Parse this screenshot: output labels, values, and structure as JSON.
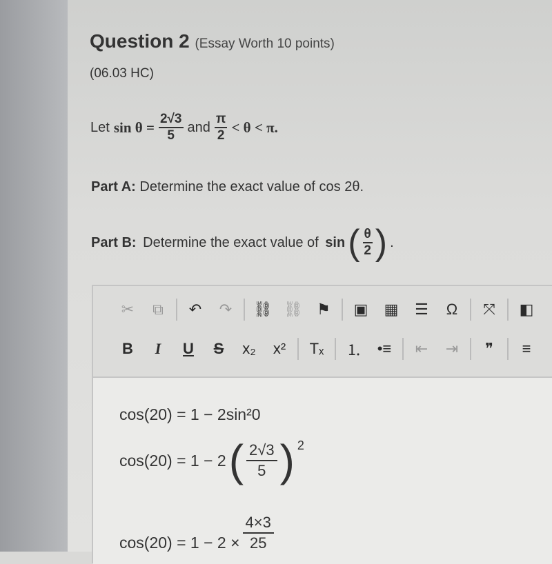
{
  "question": {
    "title": "Question 2",
    "worth": "(Essay Worth 10 points)",
    "code": "(06.03 HC)"
  },
  "given": {
    "let": "Let",
    "sin": "sin θ =",
    "num": "2√3",
    "den": "5",
    "and": "and",
    "pi": "π",
    "two": "2",
    "ineq": "< θ < π."
  },
  "part_a": {
    "label": "Part A:",
    "text": " Determine the exact value of cos 2θ."
  },
  "part_b": {
    "label": "Part B:",
    "text": " Determine the exact value of ",
    "fn": "sin",
    "num": "θ",
    "den": "2",
    "end": "."
  },
  "toolbar": {
    "row1": [
      {
        "icon": "cut-icon",
        "g": "✂",
        "dim": true
      },
      {
        "icon": "copy-icon",
        "g": "⧉",
        "dim": true
      },
      {
        "sep": true
      },
      {
        "icon": "undo-icon",
        "g": "↶"
      },
      {
        "icon": "redo-icon",
        "g": "↷",
        "dim": true
      },
      {
        "sep": true
      },
      {
        "icon": "link-icon",
        "g": "⛓"
      },
      {
        "icon": "unlink-icon",
        "g": "⛓",
        "dim": true
      },
      {
        "icon": "flag-icon",
        "g": "⚑"
      },
      {
        "sep": true
      },
      {
        "icon": "image-icon",
        "g": "▣"
      },
      {
        "icon": "table-icon",
        "g": "▦"
      },
      {
        "icon": "horizontal-line-icon",
        "g": "☰"
      },
      {
        "icon": "omega-icon",
        "g": "Ω"
      },
      {
        "sep": true
      },
      {
        "icon": "maximize-icon",
        "g": "⤧"
      },
      {
        "sep": true
      },
      {
        "icon": "source-icon",
        "g": "◧"
      }
    ],
    "row2": [
      {
        "icon": "bold-icon",
        "g": "B"
      },
      {
        "icon": "italic-icon",
        "g": "I"
      },
      {
        "icon": "underline-icon",
        "g": "U"
      },
      {
        "icon": "strikethrough-icon",
        "g": "S"
      },
      {
        "icon": "subscript-icon",
        "g": "x₂"
      },
      {
        "icon": "superscript-icon",
        "g": "x²"
      },
      {
        "sep": true
      },
      {
        "icon": "remove-format-icon",
        "g": "Tₓ"
      },
      {
        "sep": true
      },
      {
        "icon": "numbered-list-icon",
        "g": "⒈"
      },
      {
        "icon": "bulleted-list-icon",
        "g": "•≡"
      },
      {
        "sep": true
      },
      {
        "icon": "outdent-icon",
        "g": "⇤",
        "dim": true
      },
      {
        "icon": "indent-icon",
        "g": "⇥",
        "dim": true
      },
      {
        "sep": true
      },
      {
        "icon": "blockquote-icon",
        "g": "❞"
      },
      {
        "sep": true
      },
      {
        "icon": "align-icon",
        "g": "≡"
      }
    ]
  },
  "answer": {
    "line1": "cos(20) = 1 − 2sin²0",
    "line2_left": "cos(20) = 1 − 2",
    "line2_num": "2√3",
    "line2_den": "5",
    "line2_exp": "2",
    "line3_left": "cos(20) = 1 − 2 ×",
    "line3_num": "4×3",
    "line3_den": "25"
  }
}
